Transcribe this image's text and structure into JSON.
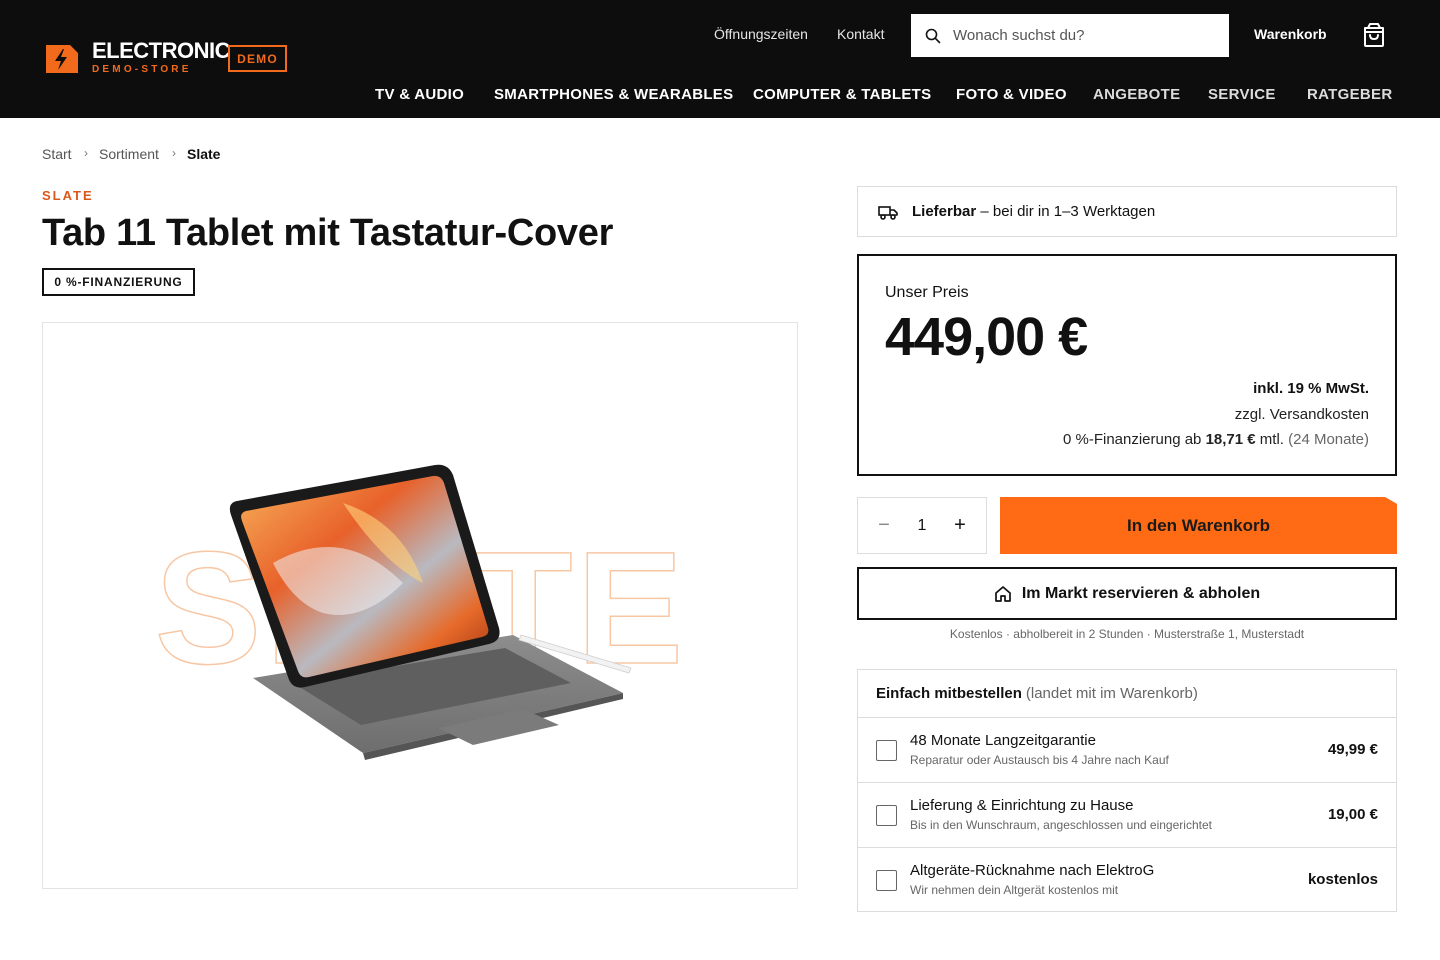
{
  "header": {
    "logo_title": "ELECTRONIC",
    "logo_subtitle": "DEMO-STORE",
    "demo_badge": "DEMO",
    "links": [
      "Öffnungszeiten",
      "Kontakt"
    ],
    "search_placeholder": "Wonach suchst du?",
    "cart_label": "Warenkorb",
    "nav": [
      "TV & AUDIO",
      "SMARTPHONES & WEARABLES",
      "COMPUTER & TABLETS",
      "FOTO & VIDEO",
      "ANGEBOTE",
      "SERVICE",
      "RATGEBER"
    ]
  },
  "breadcrumb": [
    "Start",
    "Sortiment",
    "Slate"
  ],
  "product": {
    "brand": "SLATE",
    "title": "Tab 11 Tablet mit Tastatur-Cover",
    "badge": "0 %-FINANZIERUNG",
    "watermark": "SLATE"
  },
  "availability": {
    "status": "Lieferbar",
    "detail": " – bei dir in 1–3 Werktagen"
  },
  "price_box": {
    "label": "Unser Preis",
    "price": "449,00 €",
    "tax": "inkl. 19 % MwSt.",
    "shipping": "zzgl. Versandkosten",
    "financing_prefix": "0 %-Finanzierung ab ",
    "financing_amount": "18,71 €",
    "financing_suffix": " mtl. ",
    "financing_term": "(24 Monate)"
  },
  "cart": {
    "quantity": "1",
    "minus": "−",
    "plus": "+",
    "add_button": "In den Warenkorb",
    "reserve_button": "Im Markt reservieren & abholen",
    "reserve_info": "Kostenlos · abholbereit in 2 Stunden · Musterstraße 1, Musterstadt"
  },
  "extras": {
    "title": "Einfach mitbestellen",
    "subtitle": "(landet mit im Warenkorb)",
    "items": [
      {
        "title": "48 Monate Langzeitgarantie",
        "subtitle": "Reparatur oder Austausch bis 4 Jahre nach Kauf",
        "price": "49,99 €"
      },
      {
        "title": "Lieferung & Einrichtung zu Hause",
        "subtitle": "Bis in den Wunschraum, angeschlossen und eingerichtet",
        "price": "19,00 €"
      },
      {
        "title": "Altgeräte-Rücknahme nach ElektroG",
        "subtitle": "Wir nehmen dein Altgerät kostenlos mit",
        "price": "kostenlos"
      }
    ]
  },
  "colors": {
    "accent": "#ff6a14",
    "brand_orange": "#f26a1b",
    "header_bg": "#0d0d0d"
  },
  "icons": [
    "lightning-tag-icon",
    "search-icon",
    "shopping-bag-icon",
    "truck-icon",
    "home-icon",
    "checkbox-icon"
  ]
}
